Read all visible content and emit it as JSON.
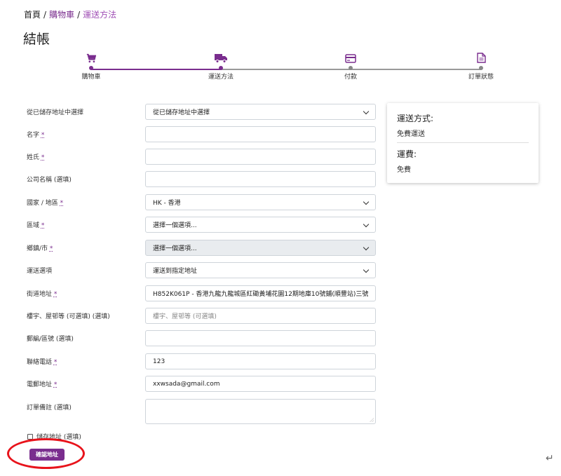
{
  "breadcrumb": {
    "home": "首頁",
    "cart": "購物車",
    "current": "運送方法",
    "separator": "/"
  },
  "page_title": "結帳",
  "steps": [
    {
      "label": "購物車",
      "icon": "cart-icon",
      "state": "done"
    },
    {
      "label": "運送方法",
      "icon": "truck-icon",
      "state": "done"
    },
    {
      "label": "付款",
      "icon": "credit-card-icon",
      "state": "todo"
    },
    {
      "label": "訂單狀態",
      "icon": "document-icon",
      "state": "todo"
    }
  ],
  "form": {
    "saved_address": {
      "label": "從已儲存地址中選擇",
      "value": "從已儲存地址中選擇"
    },
    "first_name": {
      "label": "名字",
      "required": "*",
      "value": ""
    },
    "last_name": {
      "label": "姓氏",
      "required": "*",
      "value": ""
    },
    "company": {
      "label": "公司名稱 (選填)",
      "value": ""
    },
    "country": {
      "label": "國家 / 地區",
      "required": "*",
      "value": "HK - 香港"
    },
    "region": {
      "label": "區域",
      "required": "*",
      "value": "選擇一個選項..."
    },
    "town": {
      "label": "鄉鎮/市",
      "required": "*",
      "value": "選擇一個選項..."
    },
    "delivery_option": {
      "label": "運送選項",
      "value": "運送到指定地址"
    },
    "street": {
      "label": "街道地址",
      "required": "*",
      "value": "H852K061P - 香港九龍九龍城區紅磡黃埔花園12期地庫10號鋪(順豐站)三號"
    },
    "floor": {
      "label": "樓宇、屋邨等 (可選填) (選填)",
      "placeholder": "樓宇、屋邨等 (可選填)"
    },
    "postcode": {
      "label": "郵編/區號 (選填)",
      "value": ""
    },
    "phone": {
      "label": "聯絡電話",
      "required": "*",
      "value": "123"
    },
    "email": {
      "label": "電郵地址",
      "required": "*",
      "value": "xxwsada@gmail.com"
    },
    "notes": {
      "label": "訂單備註 (選填)",
      "value": ""
    },
    "save_address": {
      "label": "儲存地址 (選填)"
    },
    "confirm_button": "確認地址"
  },
  "summary": {
    "shipping_method_title": "運送方式:",
    "shipping_method_value": "免費運送",
    "shipping_fee_title": "運費:",
    "shipping_fee_value": "免費"
  },
  "colors": {
    "accent": "#7a2d8e",
    "highlight": "#e8131b"
  }
}
